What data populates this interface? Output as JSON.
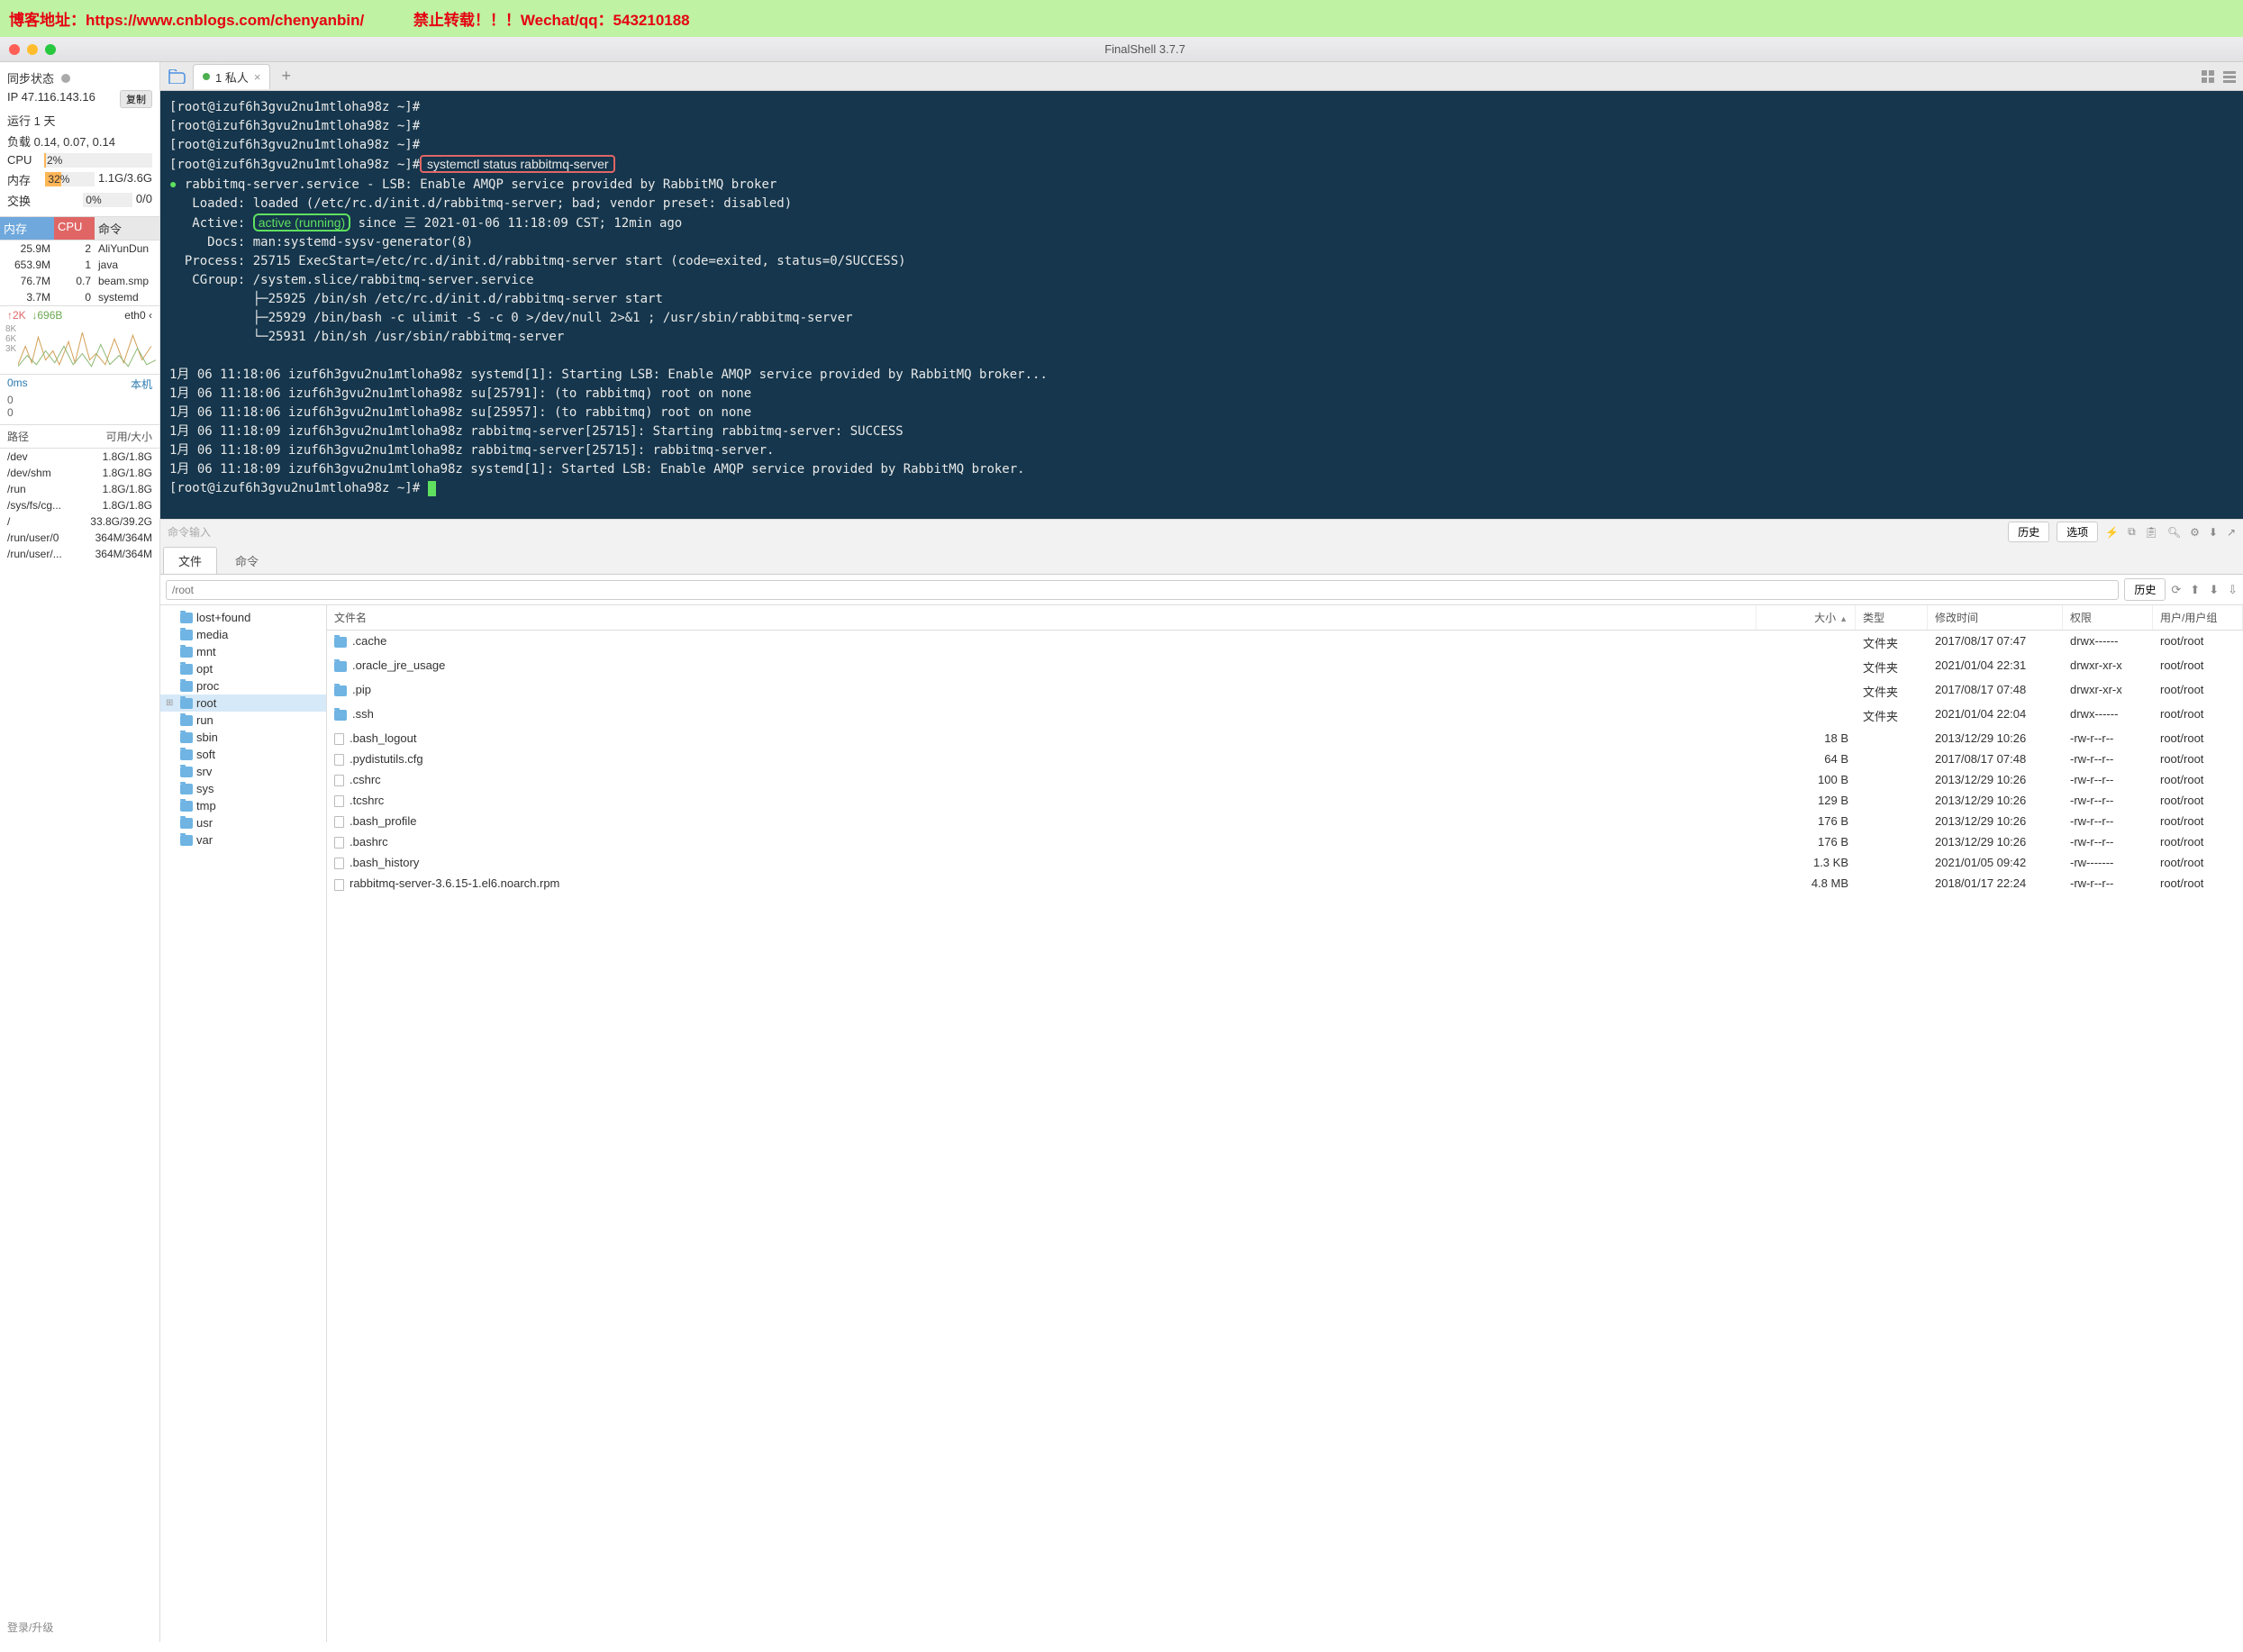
{
  "banner": {
    "left": "博客地址：https://www.cnblogs.com/chenyanbin/",
    "right": "禁止转载！！！Wechat/qq：543210188"
  },
  "titlebar": {
    "title": "FinalShell 3.7.7"
  },
  "sidebar": {
    "sync": "同步状态",
    "ip_lbl": "IP 47.116.143.16",
    "copy": "复制",
    "uptime": "运行 1 天",
    "load": "负载 0.14, 0.07, 0.14",
    "cpu_lbl": "CPU",
    "cpu_val": "2%",
    "mem_lbl": "内存",
    "mem_val": "32%",
    "mem_detail": "1.1G/3.6G",
    "swap_lbl": "交换",
    "swap_val": "0%",
    "swap_detail": "0/0",
    "head_mem": "内存",
    "head_cpu": "CPU",
    "head_cmd": "命令",
    "procs": [
      {
        "mem": "25.9M",
        "cpu": "2",
        "cmd": "AliYunDun"
      },
      {
        "mem": "653.9M",
        "cpu": "1",
        "cmd": "java"
      },
      {
        "mem": "76.7M",
        "cpu": "0.7",
        "cmd": "beam.smp"
      },
      {
        "mem": "3.7M",
        "cpu": "0",
        "cmd": "systemd"
      }
    ],
    "up": "↑2K",
    "down": "↓696B",
    "iface": "eth0",
    "iface_arrow": "‹",
    "y8": "8K",
    "y6": "6K",
    "y3": "3K",
    "lat_lbl": "0ms",
    "lat_host": "本机",
    "lat_v1": "0",
    "lat_v2": "0",
    "disk_path": "路径",
    "disk_size": "可用/大小",
    "disks": [
      {
        "p": "/dev",
        "s": "1.8G/1.8G"
      },
      {
        "p": "/dev/shm",
        "s": "1.8G/1.8G"
      },
      {
        "p": "/run",
        "s": "1.8G/1.8G"
      },
      {
        "p": "/sys/fs/cg...",
        "s": "1.8G/1.8G"
      },
      {
        "p": "/",
        "s": "33.8G/39.2G"
      },
      {
        "p": "/run/user/0",
        "s": "364M/364M"
      },
      {
        "p": "/run/user/...",
        "s": "364M/364M"
      }
    ],
    "foot": "登录/升级"
  },
  "tabs": {
    "label": "1 私人"
  },
  "terminal": {
    "p1": "[root@izuf6h3gvu2nu1mtloha98z ~]#",
    "cmd": " systemctl status rabbitmq-server ",
    "svc": "rabbitmq-server.service - LSB: Enable AMQP service provided by RabbitMQ broker",
    "loaded": "   Loaded: loaded (/etc/rc.d/init.d/rabbitmq-server; bad; vendor preset: disabled)",
    "active_pre": "   Active: ",
    "active_state": "active (running)",
    "active_post": " since 三 2021-01-06 11:18:09 CST; 12min ago",
    "docs": "     Docs: man:systemd-sysv-generator(8)",
    "process": "  Process: 25715 ExecStart=/etc/rc.d/init.d/rabbitmq-server start (code=exited, status=0/SUCCESS)",
    "cgroup": "   CGroup: /system.slice/rabbitmq-server.service",
    "cg1": "           ├─25925 /bin/sh /etc/rc.d/init.d/rabbitmq-server start",
    "cg2": "           ├─25929 /bin/bash -c ulimit -S -c 0 >/dev/null 2>&1 ; /usr/sbin/rabbitmq-server",
    "cg3": "           └─25931 /bin/sh /usr/sbin/rabbitmq-server",
    "log1": "1月 06 11:18:06 izuf6h3gvu2nu1mtloha98z systemd[1]: Starting LSB: Enable AMQP service provided by RabbitMQ broker...",
    "log2": "1月 06 11:18:06 izuf6h3gvu2nu1mtloha98z su[25791]: (to rabbitmq) root on none",
    "log3": "1月 06 11:18:06 izuf6h3gvu2nu1mtloha98z su[25957]: (to rabbitmq) root on none",
    "log4": "1月 06 11:18:09 izuf6h3gvu2nu1mtloha98z rabbitmq-server[25715]: Starting rabbitmq-server: SUCCESS",
    "log5": "1月 06 11:18:09 izuf6h3gvu2nu1mtloha98z rabbitmq-server[25715]: rabbitmq-server.",
    "log6": "1月 06 11:18:09 izuf6h3gvu2nu1mtloha98z systemd[1]: Started LSB: Enable AMQP service provided by RabbitMQ broker."
  },
  "cmdbar": {
    "ph": "命令输入",
    "history": "历史",
    "options": "选项"
  },
  "btabs": {
    "files": "文件",
    "cmds": "命令"
  },
  "pathbar": {
    "path": "/root",
    "history": "历史"
  },
  "tree": [
    "lost+found",
    "media",
    "mnt",
    "opt",
    "proc",
    "root",
    "run",
    "sbin",
    "soft",
    "srv",
    "sys",
    "tmp",
    "usr",
    "var"
  ],
  "tree_sel": "root",
  "fl_head": {
    "name": "文件名",
    "size": "大小",
    "type": "类型",
    "date": "修改时间",
    "perm": "权限",
    "own": "用户/用户组"
  },
  "files": [
    {
      "n": ".cache",
      "sz": "",
      "ty": "文件夹",
      "dt": "2017/08/17 07:47",
      "pm": "drwx------",
      "ow": "root/root",
      "f": true
    },
    {
      "n": ".oracle_jre_usage",
      "sz": "",
      "ty": "文件夹",
      "dt": "2021/01/04 22:31",
      "pm": "drwxr-xr-x",
      "ow": "root/root",
      "f": true
    },
    {
      "n": ".pip",
      "sz": "",
      "ty": "文件夹",
      "dt": "2017/08/17 07:48",
      "pm": "drwxr-xr-x",
      "ow": "root/root",
      "f": true
    },
    {
      "n": ".ssh",
      "sz": "",
      "ty": "文件夹",
      "dt": "2021/01/04 22:04",
      "pm": "drwx------",
      "ow": "root/root",
      "f": true
    },
    {
      "n": ".bash_logout",
      "sz": "18 B",
      "ty": "",
      "dt": "2013/12/29 10:26",
      "pm": "-rw-r--r--",
      "ow": "root/root",
      "f": false
    },
    {
      "n": ".pydistutils.cfg",
      "sz": "64 B",
      "ty": "",
      "dt": "2017/08/17 07:48",
      "pm": "-rw-r--r--",
      "ow": "root/root",
      "f": false
    },
    {
      "n": ".cshrc",
      "sz": "100 B",
      "ty": "",
      "dt": "2013/12/29 10:26",
      "pm": "-rw-r--r--",
      "ow": "root/root",
      "f": false
    },
    {
      "n": ".tcshrc",
      "sz": "129 B",
      "ty": "",
      "dt": "2013/12/29 10:26",
      "pm": "-rw-r--r--",
      "ow": "root/root",
      "f": false
    },
    {
      "n": ".bash_profile",
      "sz": "176 B",
      "ty": "",
      "dt": "2013/12/29 10:26",
      "pm": "-rw-r--r--",
      "ow": "root/root",
      "f": false
    },
    {
      "n": ".bashrc",
      "sz": "176 B",
      "ty": "",
      "dt": "2013/12/29 10:26",
      "pm": "-rw-r--r--",
      "ow": "root/root",
      "f": false
    },
    {
      "n": ".bash_history",
      "sz": "1.3 KB",
      "ty": "",
      "dt": "2021/01/05 09:42",
      "pm": "-rw-------",
      "ow": "root/root",
      "f": false
    },
    {
      "n": "rabbitmq-server-3.6.15-1.el6.noarch.rpm",
      "sz": "4.8 MB",
      "ty": "",
      "dt": "2018/01/17 22:24",
      "pm": "-rw-r--r--",
      "ow": "root/root",
      "f": false
    }
  ]
}
